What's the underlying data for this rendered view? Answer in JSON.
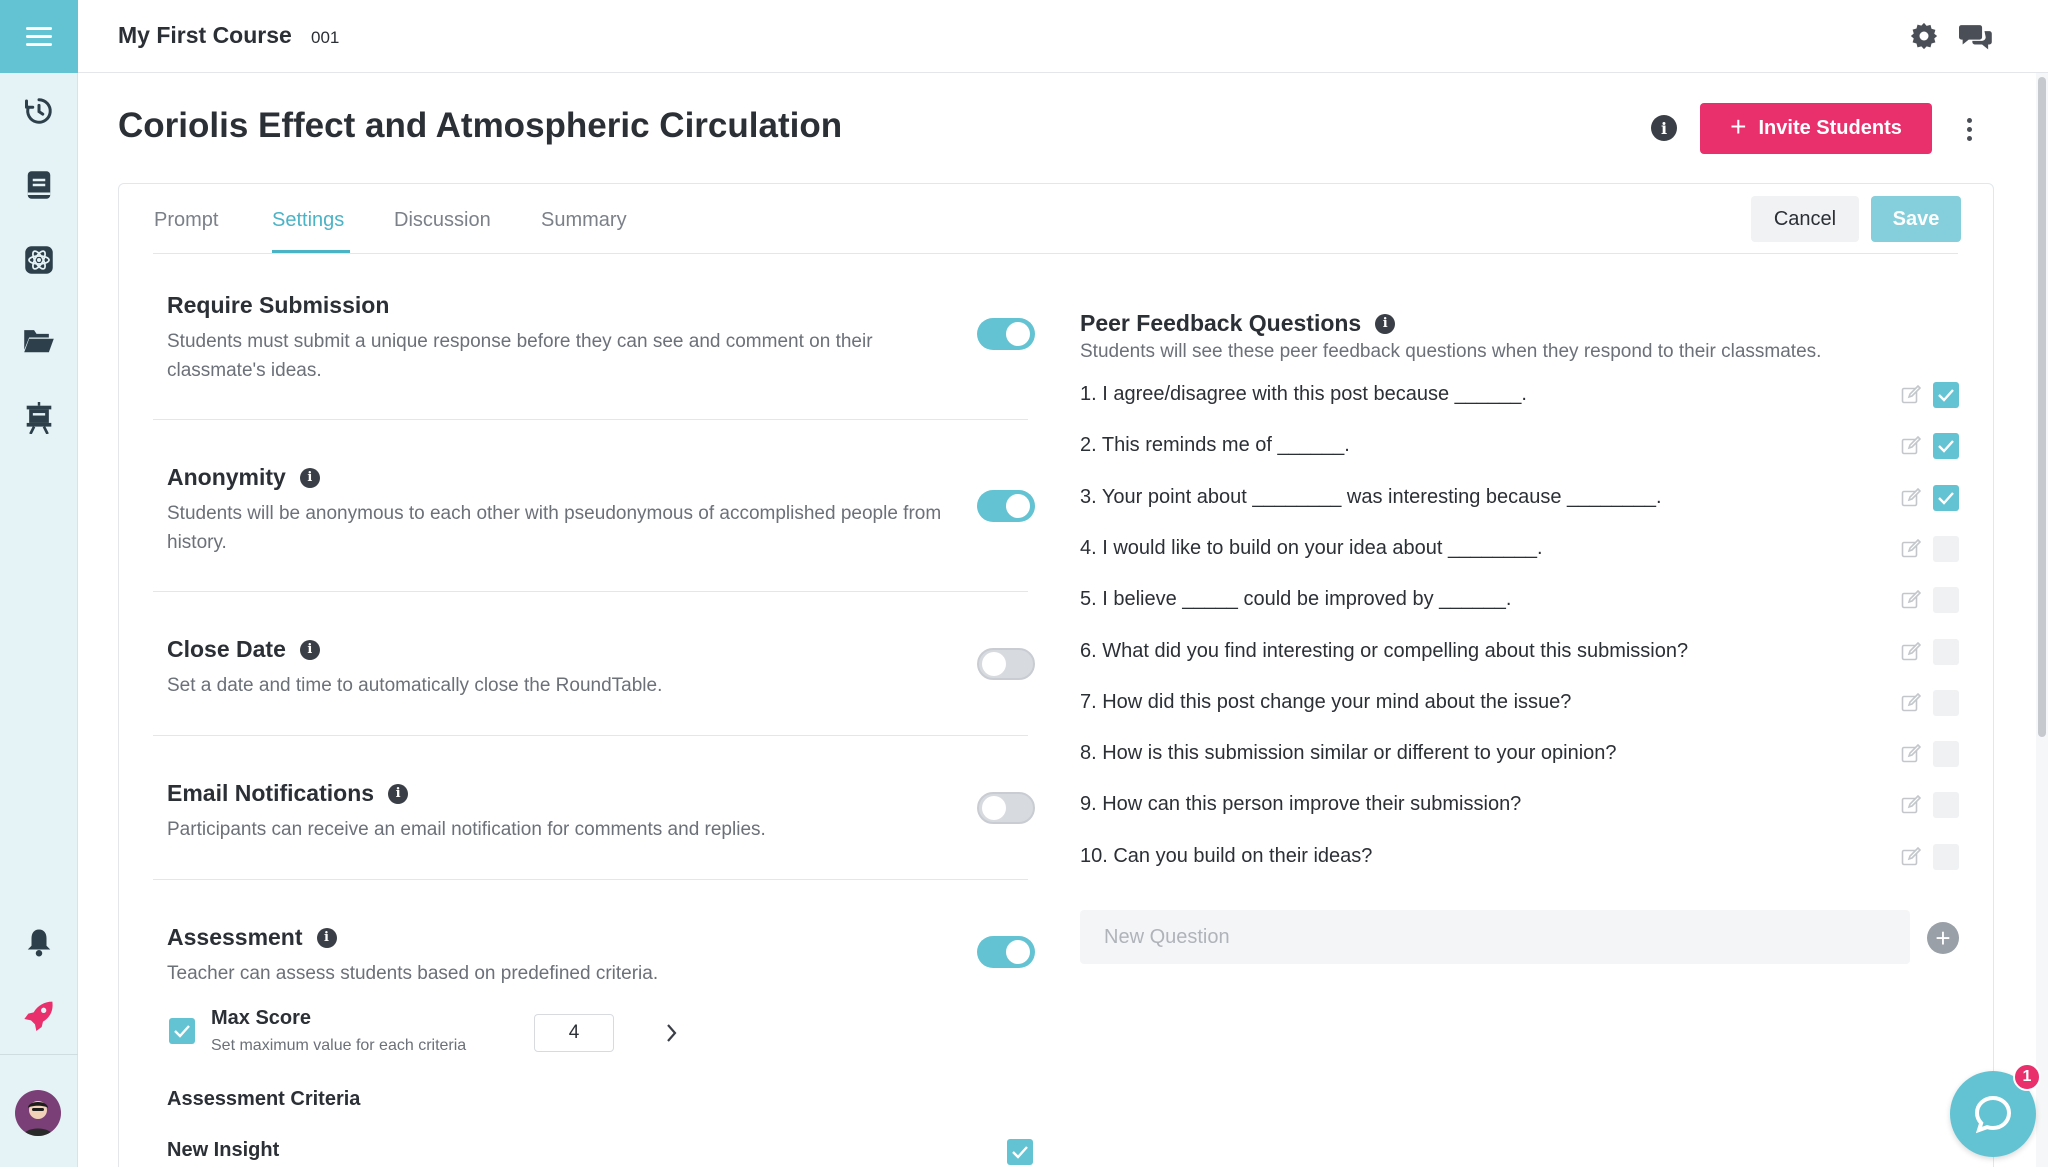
{
  "topbar": {
    "course_title": "My First Course",
    "course_code": "001"
  },
  "page": {
    "title": "Coriolis Effect and Atmospheric Circulation",
    "invite_label": "Invite Students"
  },
  "tabs": [
    {
      "label": "Prompt",
      "active": false
    },
    {
      "label": "Settings",
      "active": true
    },
    {
      "label": "Discussion",
      "active": false
    },
    {
      "label": "Summary",
      "active": false
    }
  ],
  "actions": {
    "cancel_label": "Cancel",
    "save_label": "Save"
  },
  "settings": {
    "require_submission": {
      "title": "Require Submission",
      "description": "Students must submit a unique response before they can see and comment on their classmate's ideas.",
      "enabled": true
    },
    "anonymity": {
      "title": "Anonymity",
      "description": "Students will be anonymous to each other with pseudonymous of accomplished people from history.",
      "enabled": true
    },
    "close_date": {
      "title": "Close Date",
      "description": "Set a date and time to automatically close the RoundTable.",
      "enabled": false
    },
    "email_notifications": {
      "title": "Email Notifications",
      "description": "Participants can receive an email notification for comments and replies.",
      "enabled": false
    },
    "assessment": {
      "title": "Assessment",
      "description": "Teacher can assess students based on predefined criteria.",
      "enabled": true,
      "max_score_label": "Max Score",
      "max_score_sub": "Set maximum value for each criteria",
      "max_score_checked": true,
      "max_score_value": "4",
      "criteria_heading": "Assessment Criteria",
      "criteria": [
        {
          "label": "New Insight",
          "checked": true
        }
      ]
    }
  },
  "peer_feedback": {
    "title": "Peer Feedback Questions",
    "description": "Students will see these peer feedback questions when they respond to their classmates.",
    "questions": [
      {
        "text": "1. I agree/disagree with this post because ______.",
        "checked": true
      },
      {
        "text": "2. This reminds me of ______.",
        "checked": true
      },
      {
        "text": "3. Your point about ________ was interesting because ________.",
        "checked": true
      },
      {
        "text": "4. I would like to build on your idea about ________.",
        "checked": false
      },
      {
        "text": "5. I believe _____ could be improved by ______.",
        "checked": false
      },
      {
        "text": "6. What did you find interesting or compelling about this submission?",
        "checked": false
      },
      {
        "text": "7. How did this post change your mind about the issue?",
        "checked": false
      },
      {
        "text": "8. How is this submission similar or different to your opinion?",
        "checked": false
      },
      {
        "text": "9. How can this person improve their submission?",
        "checked": false
      },
      {
        "text": "10. Can you build on their ideas?",
        "checked": false
      }
    ],
    "new_question_placeholder": "New Question"
  },
  "chat": {
    "badge_count": "1"
  },
  "colors": {
    "accent": "#63c3d2",
    "tab_active": "#4bb3c6",
    "brand_pink": "#ea2f6d",
    "sidebar_bg": "#e5f3f6"
  },
  "icons": {
    "sidebar": [
      "menu-icon",
      "history-icon",
      "notebook-icon",
      "atom-icon",
      "folder-open-icon",
      "presentation-board-icon",
      "bell-icon",
      "rocket-icon"
    ],
    "topbar": [
      "gear-icon",
      "chat-bubbles-icon"
    ]
  }
}
